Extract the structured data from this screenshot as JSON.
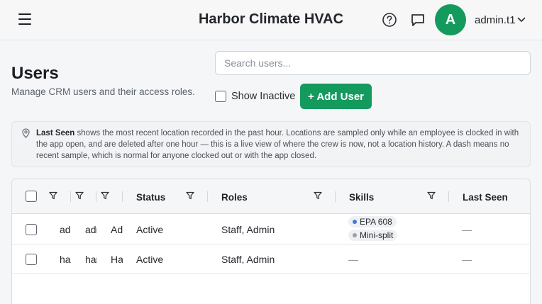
{
  "header": {
    "title": "Harbor Climate HVAC",
    "user_initial": "A",
    "username": "admin.t1",
    "icons": {
      "menu": "hamburger-icon",
      "help": "help-icon",
      "messages": "chat-icon",
      "chevron": "chevron-down-icon"
    }
  },
  "page": {
    "title": "Users",
    "subtitle": "Manage CRM users and their access roles."
  },
  "search": {
    "placeholder": "Search users...",
    "value": ""
  },
  "show_inactive": {
    "label": "Show Inactive",
    "checked": false
  },
  "add_user": {
    "label": "+ Add User"
  },
  "notice": {
    "bold": "Last Seen",
    "text": " shows the most recent location recorded in the past hour. Locations are sampled only while an employee is clocked in with the app open, and are deleted after one hour — this is a live view of where the crew is now, not a location history. A dash means no recent sample, which is normal for anyone clocked out or with the app closed."
  },
  "table": {
    "columns": [
      "Status",
      "Roles",
      "Skills",
      "Last Seen"
    ],
    "rows": [
      {
        "c1": "admin",
        "c2": "admin",
        "c3": "Admin",
        "status": "Active",
        "roles": "Staff, Admin",
        "skills": [
          "EPA 608",
          "Mini-split"
        ],
        "last_seen": "—"
      },
      {
        "c1": "harbor",
        "c2": "harbor",
        "c3": "Harbor",
        "status": "Active",
        "roles": "Staff, Admin",
        "skills_empty": "—",
        "last_seen": "—"
      }
    ]
  },
  "colors": {
    "accent": "#159a5e",
    "skill_dot_1": "#3b7ddd",
    "skill_dot_2": "#9aa0a8"
  }
}
